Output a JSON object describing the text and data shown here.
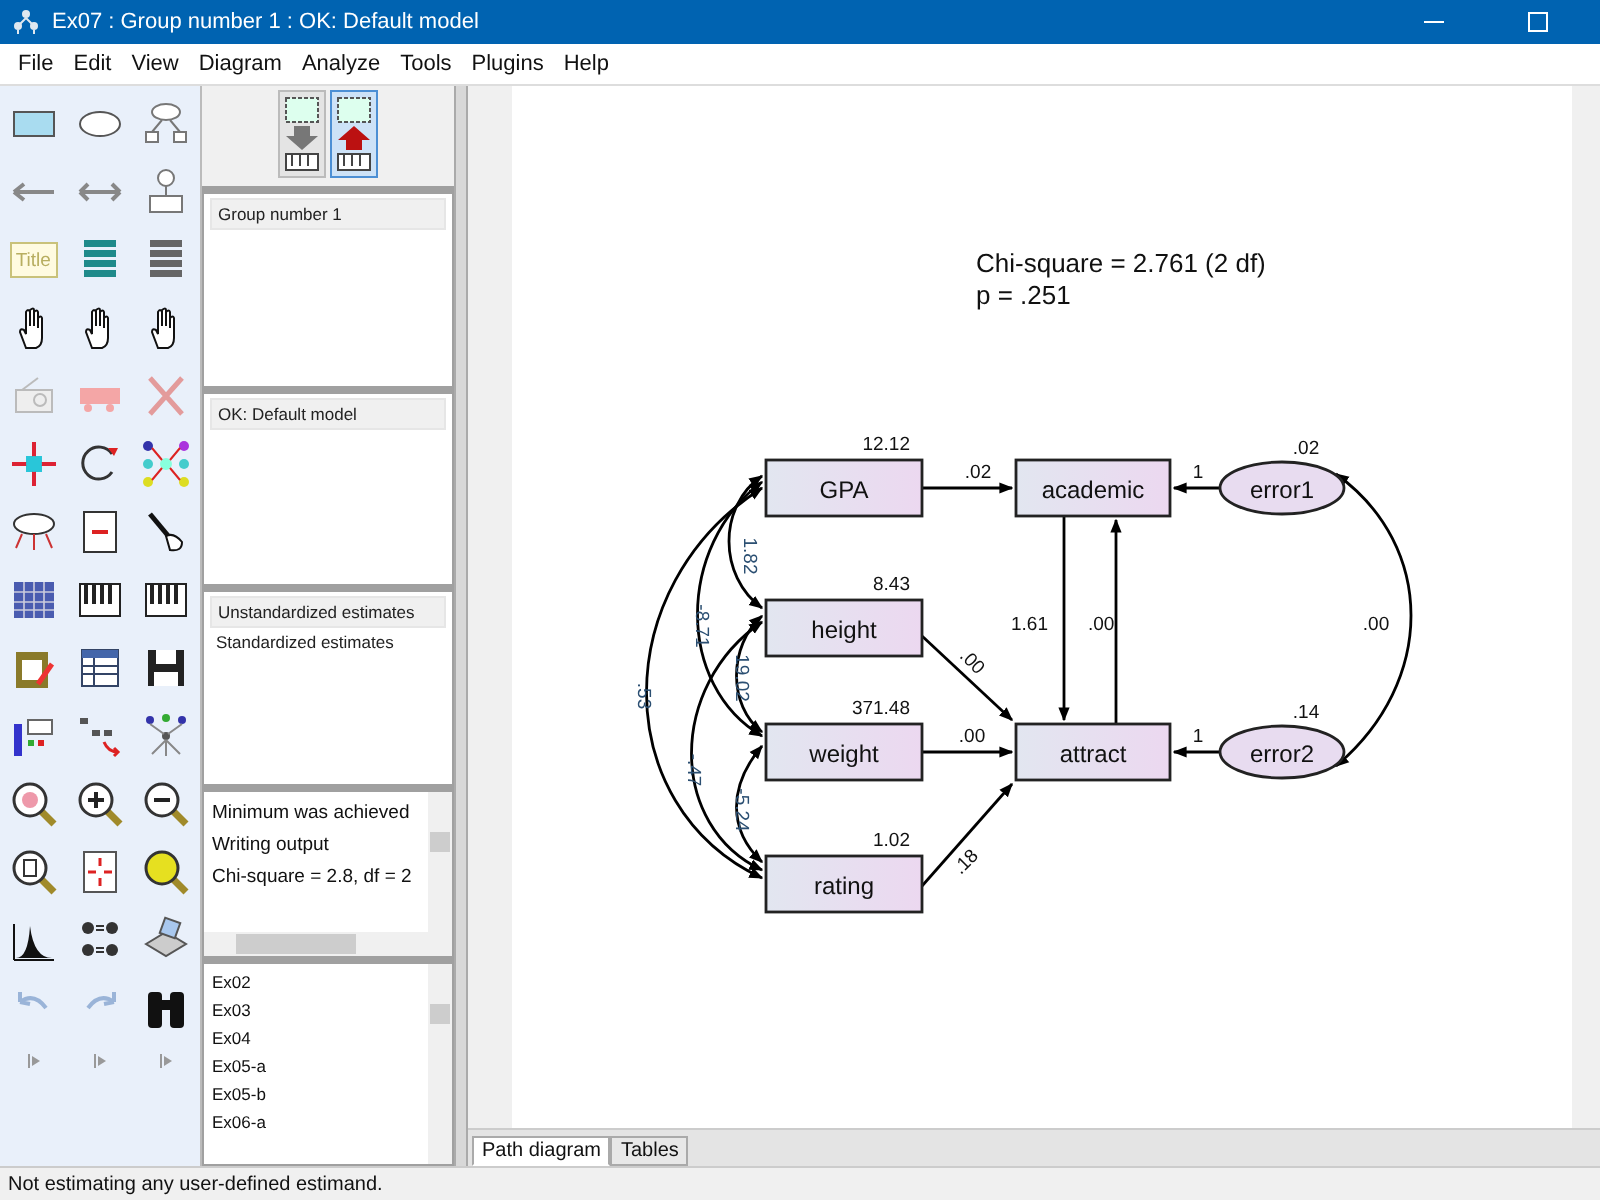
{
  "window": {
    "title": "Ex07 : Group number 1 : OK: Default model"
  },
  "menu": [
    {
      "label": "File"
    },
    {
      "label": "Edit"
    },
    {
      "label": "View"
    },
    {
      "label": "Diagram"
    },
    {
      "label": "Analyze"
    },
    {
      "label": "Tools"
    },
    {
      "label": "Plugins"
    },
    {
      "label": "Help"
    }
  ],
  "toolbar": {
    "title_tool": "Title"
  },
  "view_buttons": [
    {
      "selected": false
    },
    {
      "selected": true
    }
  ],
  "groups": [
    {
      "label": "Group number 1",
      "selected": true
    }
  ],
  "models": [
    {
      "label": "OK: Default model",
      "selected": true
    }
  ],
  "estimates": [
    {
      "label": "Unstandardized estimates",
      "selected": true
    },
    {
      "label": "Standardized estimates",
      "selected": false
    }
  ],
  "log": [
    "Minimum was achieved",
    "Writing output",
    "Chi-square = 2.8, df = 2"
  ],
  "files": [
    "Ex02",
    "Ex03",
    "Ex04",
    "Ex05-a",
    "Ex05-b",
    "Ex06-a"
  ],
  "diagram": {
    "fit_lines": [
      "Chi-square = 2.761 (2 df)",
      "p = .251"
    ],
    "nodes": [
      {
        "kind": "box",
        "label": "GPA",
        "variance": "12.12"
      },
      {
        "kind": "box",
        "label": "academic"
      },
      {
        "kind": "ellipse",
        "label": "error1",
        "variance": ".02"
      },
      {
        "kind": "box",
        "label": "height",
        "variance": "8.43"
      },
      {
        "kind": "box",
        "label": "weight",
        "variance": "371.48"
      },
      {
        "kind": "box",
        "label": "attract"
      },
      {
        "kind": "ellipse",
        "label": "error2",
        "variance": ".14"
      },
      {
        "kind": "box",
        "label": "rating",
        "variance": "1.02"
      }
    ],
    "paths": [
      {
        "kind": "regression",
        "label": ".02"
      },
      {
        "kind": "regression",
        "label": "1"
      },
      {
        "kind": "regression",
        "label": "1.61"
      },
      {
        "kind": "regression",
        "label": ".00"
      },
      {
        "kind": "regression",
        "label": ".00"
      },
      {
        "kind": "regression",
        "label": ".00"
      },
      {
        "kind": "regression",
        "label": ".18"
      },
      {
        "kind": "regression",
        "label": "1"
      },
      {
        "kind": "covariance",
        "label": ".00"
      },
      {
        "kind": "covariance",
        "label": "1.82"
      },
      {
        "kind": "covariance",
        "label": "-8.71"
      },
      {
        "kind": "covariance",
        "label": ".53"
      },
      {
        "kind": "covariance",
        "label": "19.02"
      },
      {
        "kind": "covariance",
        "label": "-.47"
      },
      {
        "kind": "covariance",
        "label": "-5.24"
      }
    ]
  },
  "tabs": [
    {
      "label": "Path diagram",
      "selected": true
    },
    {
      "label": "Tables",
      "selected": false
    }
  ],
  "status_bar": "Not estimating any user-defined estimand."
}
